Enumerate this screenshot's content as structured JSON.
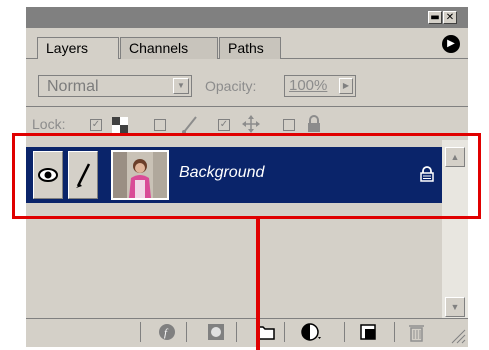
{
  "window": {
    "minimize_glyph": "▬",
    "close_glyph": "✕"
  },
  "tabs": [
    {
      "label": "Layers",
      "active": true
    },
    {
      "label": "Channels",
      "active": false
    },
    {
      "label": "Paths",
      "active": false
    }
  ],
  "palette_menu_icon": "circle-arrow-right-icon",
  "blend": {
    "mode": "Normal",
    "opacity_label": "Opacity:",
    "opacity_value": "100%"
  },
  "lock": {
    "label": "Lock:",
    "options": [
      {
        "name": "transparency",
        "icon": "checkerboard-icon"
      },
      {
        "name": "pixels",
        "icon": "brush-icon"
      },
      {
        "name": "position",
        "icon": "move-icon"
      },
      {
        "name": "all",
        "icon": "padlock-icon"
      }
    ]
  },
  "layers": [
    {
      "name": "Background",
      "visible": true,
      "selected": true,
      "locked": true
    }
  ],
  "colors": {
    "selection": "#0a246a",
    "panel": "#d4d0c8",
    "annotation": "#e00000"
  },
  "toolbar": {
    "buttons": [
      "layer-style-icon",
      "layer-mask-icon",
      "new-set-icon",
      "adjustment-layer-icon",
      "new-layer-icon",
      "trash-icon"
    ]
  }
}
